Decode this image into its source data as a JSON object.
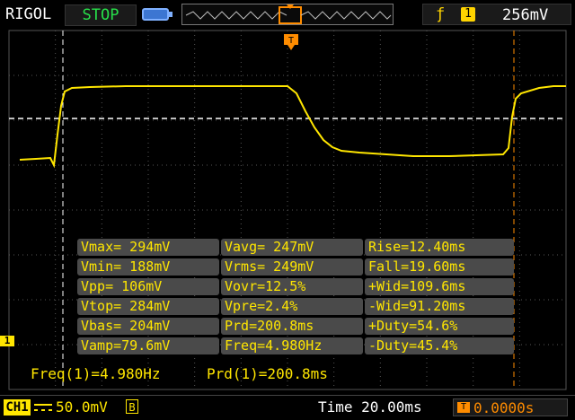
{
  "header": {
    "brand": "RIGOL",
    "run_state": "STOP",
    "trigger_edge_icon": "rising-edge-icon",
    "trigger_source": "1",
    "trigger_level": "256mV"
  },
  "colors": {
    "channel1": "#ffe600",
    "trigger": "#ff8c00",
    "run_state": "#27e04a",
    "grid": "#555555"
  },
  "measurements": [
    [
      "Vmax= 294mV",
      "Vavg= 247mV",
      "Rise=12.40ms"
    ],
    [
      "Vmin= 188mV",
      "Vrms= 249mV",
      "Fall=19.60ms"
    ],
    [
      "Vpp= 106mV",
      "Vovr=12.5%",
      "+Wid=109.6ms"
    ],
    [
      "Vtop= 284mV",
      "Vpre=2.4%",
      "-Wid=91.20ms"
    ],
    [
      "Vbas= 204mV",
      "Prd=200.8ms",
      "+Duty=54.6%"
    ],
    [
      "Vamp=79.6mV",
      "Freq=4.980Hz",
      "-Duty=45.4%"
    ]
  ],
  "counter": {
    "freq": "Freq(1)=4.980Hz",
    "period": "Prd(1)=200.8ms"
  },
  "footer": {
    "channel_label": "CH1",
    "vertical_scale": "50.0mV",
    "bandwidth_flag": "B",
    "timebase": "Time 20.00ms",
    "trigger_position": "0.0000s"
  },
  "markers": {
    "channel_ground": "1",
    "trigger_time": "T"
  }
}
